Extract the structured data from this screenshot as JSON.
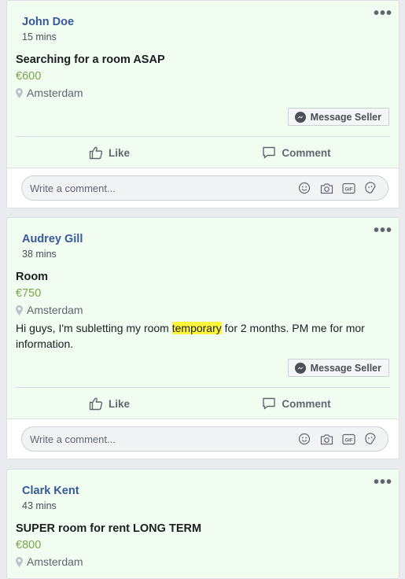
{
  "posts": [
    {
      "author": "John Doe",
      "time": "15 mins",
      "title": "Searching for a room ASAP",
      "price": "€600",
      "location": "Amsterdam",
      "description_before": "",
      "description_highlight": "",
      "description_after": "",
      "message_button": "Message Seller",
      "like_label": "Like",
      "comment_label": "Comment",
      "comment_placeholder": "Write a comment..."
    },
    {
      "author": "Audrey Gill",
      "time": "38 mins",
      "title": "Room",
      "price": "€750",
      "location": "Amsterdam",
      "description_before": "Hi guys, I'm subletting my room ",
      "description_highlight": "temporary",
      "description_after": " for 2 months. PM me for mor information.",
      "message_button": "Message Seller",
      "like_label": "Like",
      "comment_label": "Comment",
      "comment_placeholder": "Write a comment..."
    },
    {
      "author": "Clark Kent",
      "time": "43 mins",
      "title": "SUPER room for rent LONG TERM",
      "price": "€800",
      "location": "Amsterdam"
    }
  ],
  "more_icon_glyph": "•••",
  "colors": {
    "post_background": "#f1fdf1",
    "author_link": "#385898",
    "price_green": "#7aa34a",
    "highlight_yellow": "#fff63c"
  },
  "icons": [
    "more-options-icon",
    "location-pin-icon",
    "messenger-icon",
    "like-thumb-icon",
    "comment-bubble-icon",
    "emoji-icon",
    "camera-icon",
    "gif-icon",
    "sticker-icon"
  ]
}
